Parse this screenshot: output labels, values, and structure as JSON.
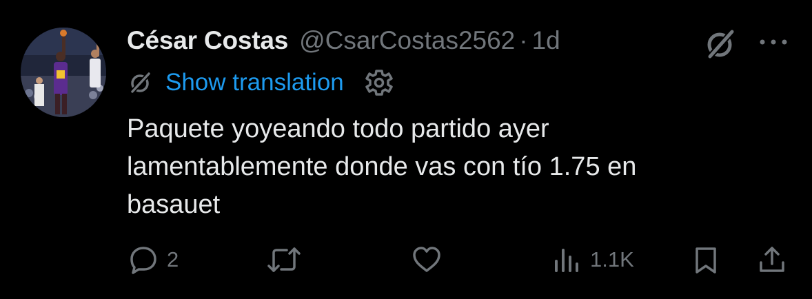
{
  "tweet": {
    "author_name": "César Costas",
    "author_handle": "@CsarCostas2562",
    "separator": "·",
    "time": "1d",
    "show_translation": "Show translation",
    "text": "Paquete yoyeando todo partido ayer\nlamentablemente donde vas con tío 1.75 en\nbasauet"
  },
  "actions": {
    "reply_count": "2",
    "views_count": "1.1K"
  },
  "icons": {
    "grok": "grok-icon",
    "more": "more-icon",
    "settings": "settings-icon",
    "reply": "reply-icon",
    "retweet": "retweet-icon",
    "like": "like-icon",
    "views": "views-icon",
    "bookmark": "bookmark-icon",
    "share": "share-icon"
  },
  "colors": {
    "background": "#000000",
    "text_primary": "#e7e9ea",
    "text_secondary": "#71767b",
    "link": "#1d9bf0"
  }
}
